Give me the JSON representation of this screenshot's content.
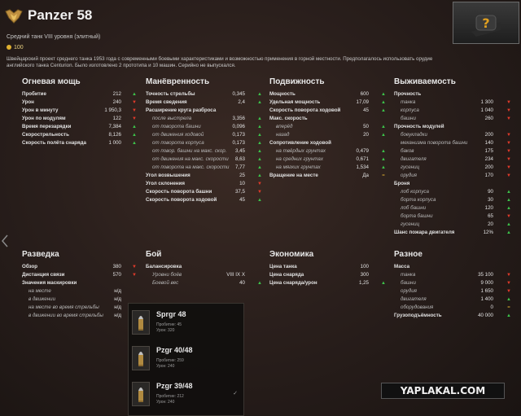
{
  "header": {
    "title": "Panzer 58",
    "subtitle": "Средний танк VIII уровня (элитный)",
    "price": "100",
    "description": "Швейцарский проект среднего танка 1953 года с современными боевыми характеристиками и возможностью применения в горной местности. Предполагалось использовать орудие английского танка Centurion. Было изготовлено 2 прототипа и 10 машин. Серийно не выпускался."
  },
  "help_button": "?",
  "colors": {
    "up": "#3cc24a",
    "down": "#e03a2a",
    "neutral": "#e0b030",
    "info": "#4a9ae0",
    "background": "#2a1f1c"
  },
  "sections": {
    "firepower": {
      "title": "Огневая мощь",
      "rows": [
        {
          "label": "Пробитие",
          "value": "212",
          "ind": "▲"
        },
        {
          "label": "Урон",
          "value": "240",
          "ind": "▼"
        },
        {
          "label": "Урон в минуту",
          "value": "1 950,3",
          "ind": "▼"
        },
        {
          "label": "Урон по модулям",
          "value": "122",
          "ind": "▼"
        },
        {
          "label": "Время перезарядки",
          "value": "7,384",
          "ind": "▲"
        },
        {
          "label": "Скорострельность",
          "value": "8,126",
          "ind": "▲"
        },
        {
          "label": "Скорость полёта снаряда",
          "value": "1 000",
          "ind": "▲"
        }
      ]
    },
    "mobility_maneuver": {
      "title": "Манёвренность",
      "rows": [
        {
          "label": "Точность стрельбы",
          "value": "0,345",
          "ind": "▲"
        },
        {
          "label": "Время сведения",
          "value": "2,4",
          "ind": "▲"
        },
        {
          "label": "Расширение круга разброса",
          "value": "",
          "ind": ""
        },
        {
          "label": "после выстрела",
          "value": "3,356",
          "ind": "▲",
          "sub": true
        },
        {
          "label": "от поворота башни",
          "value": "0,096",
          "ind": "▲",
          "sub": true
        },
        {
          "label": "от движения ходовой",
          "value": "0,173",
          "ind": "▲",
          "sub": true
        },
        {
          "label": "от поворота корпуса",
          "value": "0,173",
          "ind": "▲",
          "sub": true
        },
        {
          "label": "от повор. башни на макс. скор.",
          "value": "3,45",
          "ind": "▲",
          "sub": true
        },
        {
          "label": "от движения на макс. скорости",
          "value": "8,63",
          "ind": "▲",
          "sub": true
        },
        {
          "label": "от поворота на макс. скорости",
          "value": "7,77",
          "ind": "▲",
          "sub": true
        },
        {
          "label": "Угол возвышения",
          "value": "25",
          "ind": "▲"
        },
        {
          "label": "Угол склонения",
          "value": "10",
          "ind": "▼"
        },
        {
          "label": "Скорость поворота башни",
          "value": "37,5",
          "ind": "▼"
        },
        {
          "label": "Скорость поворота ходовой",
          "value": "45",
          "ind": "▲"
        }
      ]
    },
    "mobility": {
      "title": "Подвижность",
      "rows": [
        {
          "label": "Мощность",
          "value": "600",
          "ind": "▲"
        },
        {
          "label": "Удельная мощность",
          "value": "17,09",
          "ind": "▲"
        },
        {
          "label": "Скорость поворота ходовой",
          "value": "45",
          "ind": "▲"
        },
        {
          "label": "Макс. скорость",
          "value": "",
          "ind": ""
        },
        {
          "label": "вперёд",
          "value": "50",
          "ind": "▲",
          "sub": true
        },
        {
          "label": "назад",
          "value": "20",
          "ind": "▲",
          "sub": true
        },
        {
          "label": "Сопротивление ходовой",
          "value": "",
          "ind": ""
        },
        {
          "label": "на твёрдых грунтах",
          "value": "0,479",
          "ind": "▲",
          "sub": true
        },
        {
          "label": "на средних грунтах",
          "value": "0,671",
          "ind": "▲",
          "sub": true
        },
        {
          "label": "на мягких грунтах",
          "value": "1,534",
          "ind": "▲",
          "sub": true
        },
        {
          "label": "Вращение на месте",
          "value": "Да",
          "ind": "="
        }
      ]
    },
    "survivability": {
      "title": "Выживаемость",
      "rows": [
        {
          "label": "Прочность",
          "value": "",
          "ind": ""
        },
        {
          "label": "танка",
          "value": "1 300",
          "ind": "▼",
          "sub": true
        },
        {
          "label": "корпуса",
          "value": "1 040",
          "ind": "▼",
          "sub": true
        },
        {
          "label": "башни",
          "value": "260",
          "ind": "▼",
          "sub": true
        },
        {
          "label": "Прочность модулей",
          "value": "",
          "ind": ""
        },
        {
          "label": "боеукладки",
          "value": "200",
          "ind": "▼",
          "sub": true
        },
        {
          "label": "механизма поворота башни",
          "value": "140",
          "ind": "▼",
          "sub": true
        },
        {
          "label": "баков",
          "value": "175",
          "ind": "▼",
          "sub": true
        },
        {
          "label": "двигателя",
          "value": "234",
          "ind": "▼",
          "sub": true
        },
        {
          "label": "гусениц",
          "value": "200",
          "ind": "▼",
          "sub": true
        },
        {
          "label": "орудия",
          "value": "170",
          "ind": "▼",
          "sub": true
        },
        {
          "label": "Броня",
          "value": "",
          "ind": ""
        },
        {
          "label": "лоб корпуса",
          "value": "90",
          "ind": "▲",
          "sub": true
        },
        {
          "label": "борта корпуса",
          "value": "30",
          "ind": "▲",
          "sub": true
        },
        {
          "label": "лоб башни",
          "value": "120",
          "ind": "▲",
          "sub": true
        },
        {
          "label": "борта башни",
          "value": "65",
          "ind": "▼",
          "sub": true
        },
        {
          "label": "гусениц",
          "value": "20",
          "ind": "▲",
          "sub": true
        },
        {
          "label": "Шанс пожара двигателя",
          "value": "12%",
          "ind": "▲"
        }
      ]
    },
    "spotting": {
      "title": "Разведка",
      "rows": [
        {
          "label": "Обзор",
          "value": "380",
          "ind": "▼"
        },
        {
          "label": "Дистанция связи",
          "value": "570",
          "ind": "▼"
        },
        {
          "label": "Значения маскировки",
          "value": "",
          "ind": ""
        },
        {
          "label": "на месте",
          "value": "н/д",
          "ind": "",
          "sub": true
        },
        {
          "label": "в движении",
          "value": "н/д",
          "ind": "",
          "sub": true
        },
        {
          "label": "на месте во время стрельбы",
          "value": "н/д",
          "ind": "",
          "sub": true
        },
        {
          "label": "в движении во время стрельбы",
          "value": "н/д",
          "ind": "",
          "sub": true
        }
      ]
    },
    "battle": {
      "title": "Бой",
      "rows": [
        {
          "label": "Балансировка",
          "value": "",
          "ind": ""
        },
        {
          "label": "Уровни боёв",
          "value": "VIII IX X",
          "ind": "",
          "sub": true
        },
        {
          "label": "Боевой вес",
          "value": "40",
          "ind": "▲",
          "sub": true
        }
      ]
    },
    "economy": {
      "title": "Экономика",
      "rows": [
        {
          "label": "Цена танка",
          "value": "100",
          "ind": ""
        },
        {
          "label": "Цена снаряда",
          "value": "300",
          "ind": ""
        },
        {
          "label": "Цена снаряда/урон",
          "value": "1,25",
          "ind": "▲"
        }
      ]
    },
    "misc": {
      "title": "Разное",
      "rows": [
        {
          "label": "Масса",
          "value": "",
          "ind": ""
        },
        {
          "label": "танка",
          "value": "35 100",
          "ind": "▼",
          "sub": true
        },
        {
          "label": "башни",
          "value": "9 000",
          "ind": "▼",
          "sub": true
        },
        {
          "label": "орудия",
          "value": "1 650",
          "ind": "▼",
          "sub": true
        },
        {
          "label": "двигателя",
          "value": "1 400",
          "ind": "▲",
          "sub": true
        },
        {
          "label": "оборудования",
          "value": "0",
          "ind": "=",
          "sub": true
        },
        {
          "label": "Грузоподъёмность",
          "value": "40 000",
          "ind": "▲"
        }
      ]
    }
  },
  "shells": [
    {
      "name": "Sprgr 48",
      "pen": "Пробитие: 45",
      "dmg": "Урон: 320",
      "check": ""
    },
    {
      "name": "Pzgr 40/48",
      "pen": "Пробитие: 259",
      "dmg": "Урон: 240",
      "check": ""
    },
    {
      "name": "Pzgr 39/48",
      "pen": "Пробитие: 212",
      "dmg": "Урон: 240",
      "check": "✓"
    }
  ],
  "watermark": "YAPLAKAL.COM"
}
